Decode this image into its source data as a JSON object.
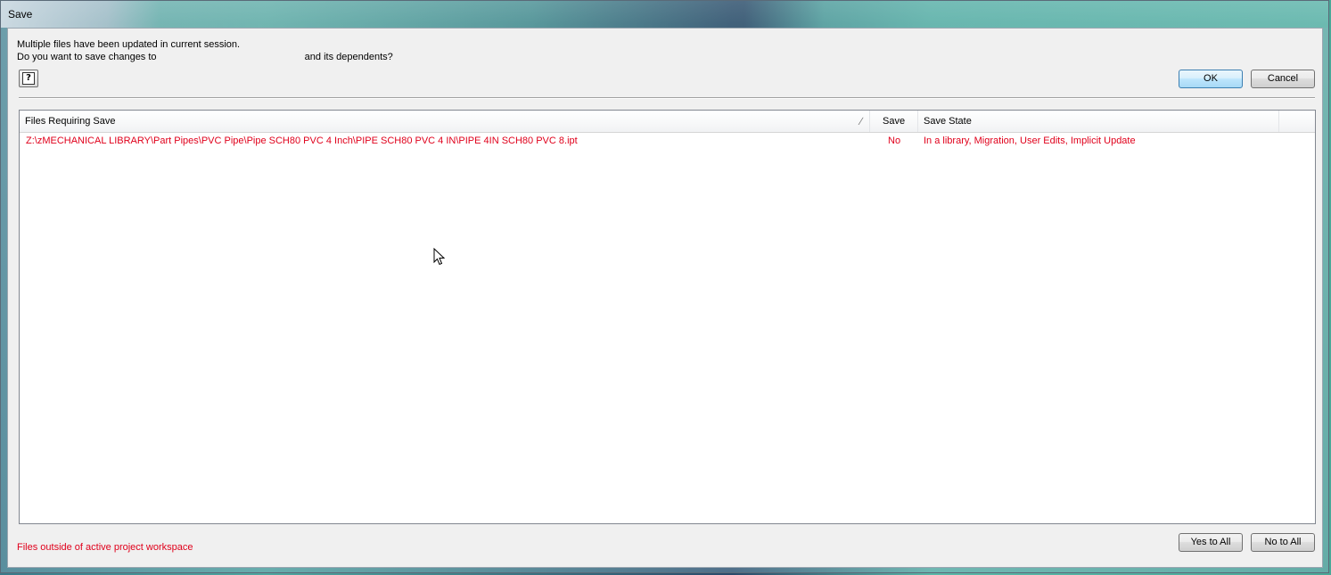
{
  "window": {
    "title": "Save"
  },
  "message": {
    "line1": "Multiple files have been updated in current session.",
    "line2_prefix": "Do you want to save changes to",
    "line2_suffix": "and its dependents?"
  },
  "buttons": {
    "ok": "OK",
    "cancel": "Cancel",
    "yes_to_all": "Yes to All",
    "no_to_all": "No to All"
  },
  "table": {
    "columns": {
      "files": "Files Requiring Save",
      "save": "Save",
      "state": "Save State"
    },
    "rows": [
      {
        "file": "Z:\\zMECHANICAL LIBRARY\\Part Pipes\\PVC Pipe\\Pipe SCH80 PVC 4 Inch\\PIPE SCH80 PVC 4 IN\\PIPE 4IN SCH80 PVC 8.ipt",
        "save": "No",
        "state": "In a library, Migration, User Edits, Implicit Update"
      }
    ]
  },
  "footer": {
    "note": "Files outside of active project workspace"
  },
  "icons": {
    "help": "help-icon",
    "sort": "sort-indicator-icon",
    "cursor": "mouse-pointer-icon"
  },
  "colors": {
    "warning_text": "#e0001b",
    "default_button_border": "#3c7fb1"
  }
}
